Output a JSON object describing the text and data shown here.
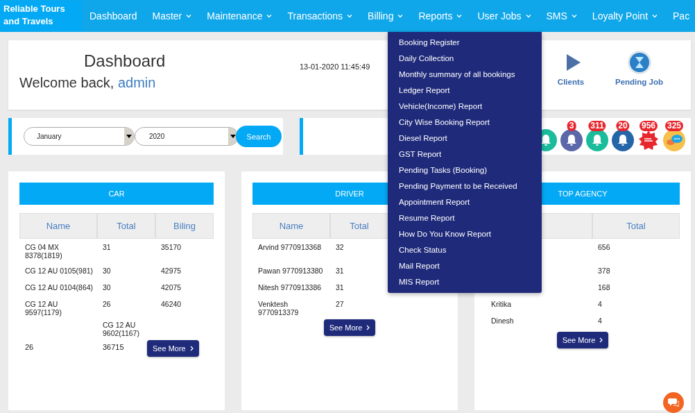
{
  "navbar": {
    "logo": "Reliable Tours and Travels",
    "menu": [
      {
        "label": "Dashboard",
        "has_dropdown": false,
        "expanded": false
      },
      {
        "label": "Master",
        "has_dropdown": true,
        "expanded": false
      },
      {
        "label": "Maintenance",
        "has_dropdown": true,
        "expanded": false
      },
      {
        "label": "Transactions",
        "has_dropdown": true,
        "expanded": false
      },
      {
        "label": "Billing",
        "has_dropdown": true,
        "expanded": false
      },
      {
        "label": "Reports",
        "has_dropdown": true,
        "expanded": true
      },
      {
        "label": "User Jobs",
        "has_dropdown": true,
        "expanded": false
      },
      {
        "label": "SMS",
        "has_dropdown": true,
        "expanded": false
      },
      {
        "label": "Loyalty Point",
        "has_dropdown": true,
        "expanded": false
      },
      {
        "label": "Pac",
        "has_dropdown": false,
        "expanded": false
      }
    ]
  },
  "reports_menu": [
    "Booking Register",
    "Daily Collection",
    "Monthly summary of all bookings",
    "Ledger Report",
    "Vehicle(Income) Report",
    "City Wise Booking Report",
    "Diesel Report",
    "GST Report",
    "Pending Tasks (Booking)",
    "Pending Payment to be Received",
    "Appointment Report",
    "Resume Report",
    "How Do You Know Report",
    "Check Status",
    "Mail Report",
    "MIS Report"
  ],
  "header": {
    "title": "Dashboard",
    "welcome": "Welcome back,",
    "user": "admin",
    "datetime": "13-01-2020 11:45:49",
    "tiles": [
      {
        "label": "Clients",
        "kind": "clients"
      },
      {
        "label": "Pending Job",
        "kind": "hourglass"
      }
    ]
  },
  "filter": {
    "month": "January",
    "year": "2020",
    "button": "Search"
  },
  "notifications": [
    {
      "kind": "bell",
      "color": "#1abc9c"
    },
    {
      "kind": "bell",
      "color": "#5b67a8",
      "badge": "3"
    },
    {
      "kind": "bell",
      "color": "#1abc9c",
      "badge": "311"
    },
    {
      "kind": "bell",
      "color": "#2566a8",
      "badge": "20"
    },
    {
      "kind": "offer",
      "color": "#e8262d",
      "badge": "956"
    },
    {
      "kind": "chat",
      "color": "#f6c04a",
      "badge": "325"
    }
  ],
  "cards": [
    {
      "kind": "car",
      "title": "CAR",
      "columns": [
        "Name",
        "Total",
        "Biling"
      ],
      "rows": [
        [
          "CG 04 MX 8378(1819)",
          "31",
          "35170"
        ],
        [
          "CG 12 AU 0105(981)",
          "30",
          "42975"
        ],
        [
          "CG 12 AU 0104(864)",
          "30",
          "42075"
        ],
        [
          "CG 12 AU 9597(1179)",
          "26",
          "46240"
        ]
      ],
      "stray_cell": "CG 12 AU 9602(1167)",
      "footer_cells": [
        "26",
        "36715"
      ],
      "button": "See More"
    },
    {
      "kind": "driver",
      "title": "DRIVER",
      "columns": [
        "Name",
        "Total",
        null
      ],
      "rows": [
        [
          "Arvind 9770913368",
          "32",
          null
        ],
        [
          "Pawan 9770913380",
          "31",
          null
        ],
        [
          "Nitesh 9770913386",
          "31",
          null
        ],
        [
          "Venktesh 9770913379",
          "27",
          null
        ]
      ],
      "button": "See More"
    },
    {
      "kind": "agency",
      "title": "TOP AGENCY",
      "columns": [
        null,
        "Total"
      ],
      "rows": [
        [
          null,
          "656"
        ],
        [
          null,
          "378"
        ],
        [
          null,
          "168"
        ],
        [
          "Kritika",
          "4"
        ],
        [
          "Dinesh",
          "4"
        ]
      ],
      "button": "See More"
    }
  ]
}
